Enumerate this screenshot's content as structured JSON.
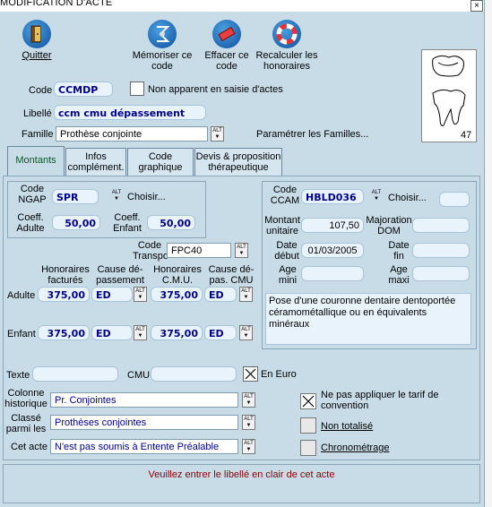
{
  "window": {
    "title": "MODIFICATION D'ACTE",
    "close_label": "×"
  },
  "toolbar": {
    "quit": "Quitter",
    "memorize": "Mémoriser ce code",
    "erase": "Effacer ce code",
    "recalc": "Recalculer les honoraires"
  },
  "tooth": {
    "number": "47"
  },
  "code": {
    "label": "Code",
    "value": "CCMDP",
    "apparent_label": "Non apparent en saisie d'actes"
  },
  "libelle": {
    "label": "Libellé",
    "value": "ccm cmu dépassement"
  },
  "famille": {
    "label": "Famille",
    "value": "Prothèse conjointe",
    "param_label": "Paramétrer les Familles..."
  },
  "alt_text": "ALT",
  "tabs": [
    {
      "label": "Montants"
    },
    {
      "label": "Infos complément."
    },
    {
      "label": "Code graphique"
    },
    {
      "label": "Devis & proposition thérapeutique"
    }
  ],
  "ngap": {
    "code_label": "Code NGAP",
    "code_value": "SPR",
    "choose_label": "Choisir...",
    "coeff_adult_label": "Coeff. Adulte",
    "coeff_adult_value": "50,00",
    "coeff_child_label": "Coeff. Enfant",
    "coeff_child_value": "50,00"
  },
  "ccam": {
    "code_label": "Code CCAM",
    "code_value": "HBLD036",
    "choose_label": "Choisir...",
    "choose_value": "",
    "montant_label": "Montant unitaire",
    "montant_value": "107,50",
    "majoration_label": "Majoration DOM",
    "majoration_value": "",
    "date_debut_label": "Date début",
    "date_debut_value": "01/03/2005",
    "date_fin_label": "Date fin",
    "date_fin_value": "",
    "age_min_label": "Age mini",
    "age_min_value": "",
    "age_max_label": "Age maxi",
    "age_max_value": "",
    "description": "Pose d'une couronne dentaire dentoportée céramométallique ou en équivalents minéraux"
  },
  "transpo": {
    "label": "Code Transpo",
    "value": "FPC40"
  },
  "honoraires": {
    "headers": [
      "Honoraires facturés",
      "Cause dé-passement",
      "Honoraires C.M.U.",
      "Cause dé-pas. CMU"
    ],
    "rows": [
      {
        "label": "Adulte",
        "fact": "375,00",
        "cause": "ED",
        "cmu": "375,00",
        "cause_cmu": "ED"
      },
      {
        "label": "Enfant",
        "fact": "375,00",
        "cause": "ED",
        "cmu": "375,00",
        "cause_cmu": "ED"
      }
    ]
  },
  "texte": {
    "label": "Texte",
    "value": "",
    "cmu_label": "CMU",
    "cmu_value": "",
    "euro_label": "En Euro"
  },
  "colonne": {
    "label": "Colonne historique",
    "value": "Pr. Conjointes"
  },
  "classe": {
    "label": "Classé parmi les",
    "value": "Prothèses conjointes"
  },
  "cet_acte": {
    "label": "Cet acte",
    "value": "N'est pas soumis à Entente Préalable"
  },
  "options": {
    "no_tarif": "Ne pas appliquer le tarif de convention",
    "non_totalise": "Non totalisé",
    "chrono": "Chronométrage"
  },
  "status": {
    "message": "Veuillez entrer le libellé en clair de cet acte"
  },
  "colors": {
    "accent": "#00008a",
    "status": "#8b0000",
    "tab_active": "#006020",
    "background": "#c8dce8"
  }
}
